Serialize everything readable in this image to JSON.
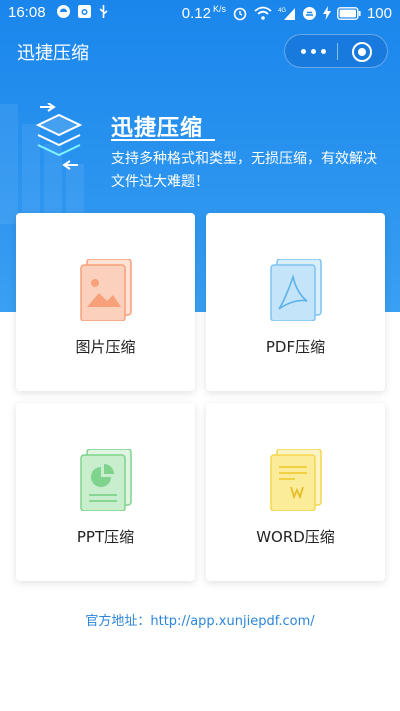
{
  "statusbar": {
    "time": "16:08",
    "net_speed": "0.12",
    "net_unit": "K/s",
    "network_type": "4G",
    "battery": "100",
    "icons": [
      "circle-icon",
      "image-icon",
      "usb-icon",
      "alarm-icon",
      "wifi-icon",
      "signal-icon",
      "battery-icon"
    ]
  },
  "header": {
    "title": "迅捷压缩",
    "capsule_icons": [
      "more-icon",
      "close-target-icon"
    ]
  },
  "banner": {
    "title": "迅捷压缩",
    "description": "支持多种格式和类型，无损压缩，有效解决文件过大难题！",
    "icon": "layers-icon"
  },
  "tools": [
    {
      "label": "图片压缩",
      "icon": "image-file-icon",
      "color": "#f7a07a"
    },
    {
      "label": "PDF压缩",
      "icon": "pdf-file-icon",
      "color": "#7cc3f2"
    },
    {
      "label": "PPT压缩",
      "icon": "ppt-file-icon",
      "color": "#7fd38c"
    },
    {
      "label": "WORD压缩",
      "icon": "word-file-icon",
      "color": "#f4d64e"
    }
  ],
  "footer": {
    "text": "官方地址：http://app.xunjiepdf.com/"
  },
  "colors": {
    "primary": "#1a86ec",
    "link": "#2b86d9"
  }
}
